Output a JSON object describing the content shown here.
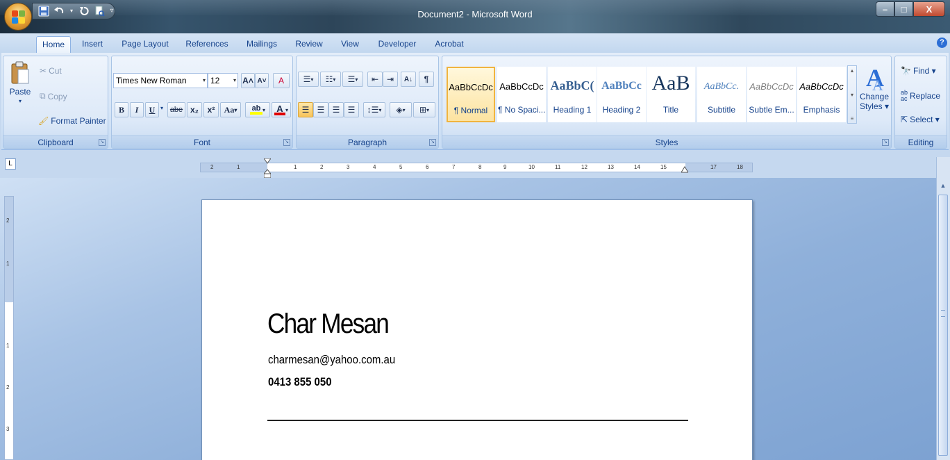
{
  "window": {
    "title": "Document2 - Microsoft Word",
    "minimize": "–",
    "maximize": "□",
    "close": "X"
  },
  "qat": {
    "save": "save",
    "undo": "undo",
    "redo": "redo",
    "print_preview": "print-preview",
    "customize": "▿"
  },
  "tabs": [
    "Home",
    "Insert",
    "Page Layout",
    "References",
    "Mailings",
    "Review",
    "View",
    "Developer",
    "Acrobat"
  ],
  "help": "?",
  "clipboard": {
    "label": "Clipboard",
    "paste": "Paste",
    "cut": "Cut",
    "copy": "Copy",
    "format_painter": "Format Painter"
  },
  "font": {
    "label": "Font",
    "family": "Times New Roman",
    "size": "12",
    "grow": "A˄",
    "shrink": "A˅",
    "clear": "A",
    "bold": "B",
    "italic": "I",
    "underline": "U",
    "strike": "abe",
    "subscript": "x₂",
    "superscript": "x²",
    "change_case": "Aa",
    "highlight": "ab",
    "font_color": "A"
  },
  "paragraph": {
    "label": "Paragraph",
    "show_marks": "¶"
  },
  "styles": {
    "label": "Styles",
    "items": [
      {
        "sample": "AaBbCcDc",
        "name": "¶ Normal"
      },
      {
        "sample": "AaBbCcDc",
        "name": "¶ No Spaci..."
      },
      {
        "sample": "AaBbC(",
        "name": "Heading 1"
      },
      {
        "sample": "AaBbCc",
        "name": "Heading 2"
      },
      {
        "sample": "AaB",
        "name": "Title"
      },
      {
        "sample": "AaBbCc.",
        "name": "Subtitle"
      },
      {
        "sample": "AaBbCcDc",
        "name": "Subtle Em..."
      },
      {
        "sample": "AaBbCcDc",
        "name": "Emphasis"
      }
    ],
    "change_styles": "Change Styles ▾"
  },
  "editing": {
    "label": "Editing",
    "find": "Find ▾",
    "replace": "Replace",
    "select": "Select ▾"
  },
  "ruler": {
    "tab_selector": "L",
    "h_ticks": [
      "2",
      "1",
      "1",
      "2",
      "3",
      "4",
      "5",
      "6",
      "7",
      "8",
      "9",
      "10",
      "11",
      "12",
      "13",
      "14",
      "15",
      "17",
      "18"
    ],
    "v_ticks": [
      "2",
      "1",
      "1",
      "2",
      "3"
    ]
  },
  "document": {
    "name": "Char Mesan",
    "email": "charmesan@yahoo.com.au",
    "phone": "0413 855 050"
  },
  "colors": {
    "selected_style_border": "#f1b43e",
    "ribbon_text": "#15428b",
    "font_color_bar": "#e00000",
    "highlight_bar": "#ffff00"
  }
}
